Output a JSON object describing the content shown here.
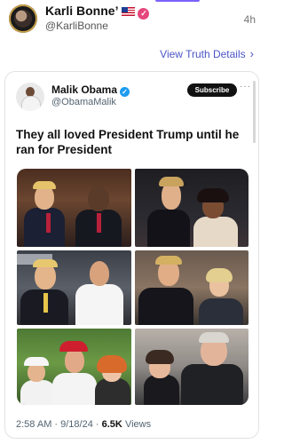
{
  "post": {
    "author_name": "Karli Bonne’",
    "author_handle": "@KarliBonne",
    "time_ago": "4h",
    "view_details_label": "View Truth Details",
    "chevron_icon": "chevron-right-icon"
  },
  "embedded_tweet": {
    "author_name": "Malik Obama",
    "author_handle": "@ObamaMalik",
    "subscribe_label": "Subscribe",
    "more_label": "···",
    "text": "They all loved President Trump until he ran for President",
    "timestamp": "2:58 AM · 9/18/24 ·",
    "views_count": "6.5K",
    "views_label": "Views"
  },
  "colors": {
    "accent_link": "#4a55c8",
    "verified_truth": "#e5477d",
    "verified_tweet": "#1d9bf0"
  }
}
